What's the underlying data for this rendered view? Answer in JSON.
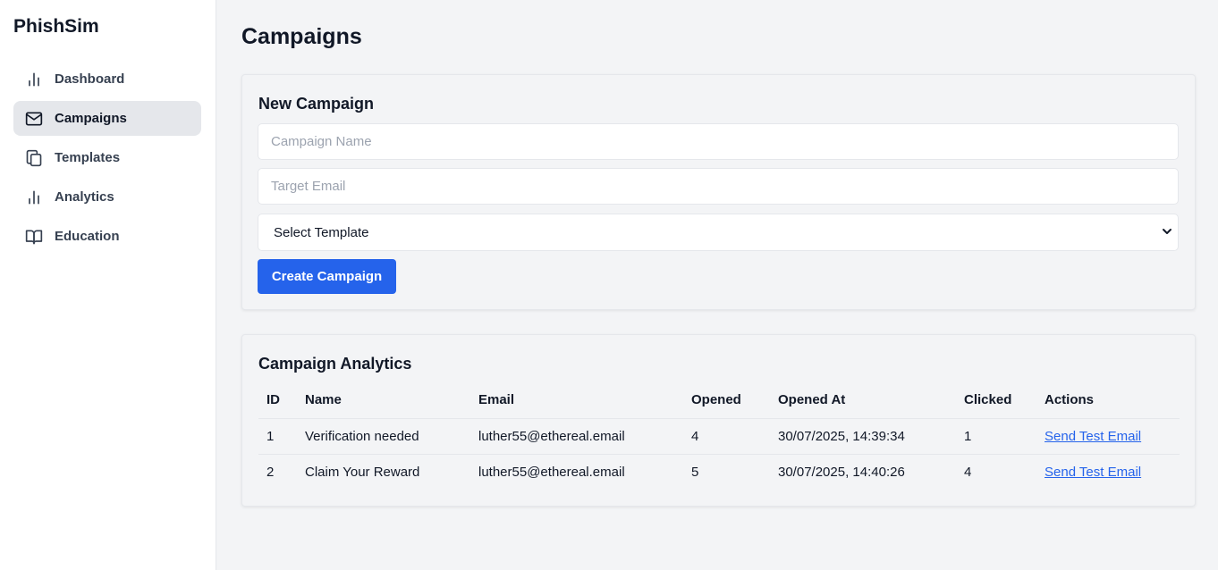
{
  "app": {
    "brand": "PhishSim"
  },
  "sidebar": {
    "items": [
      {
        "label": "Dashboard",
        "icon": "bar-chart-icon",
        "active": false
      },
      {
        "label": "Campaigns",
        "icon": "mail-icon",
        "active": true
      },
      {
        "label": "Templates",
        "icon": "copy-icon",
        "active": false
      },
      {
        "label": "Analytics",
        "icon": "bar-chart-icon",
        "active": false
      },
      {
        "label": "Education",
        "icon": "book-icon",
        "active": false
      }
    ]
  },
  "main": {
    "title": "Campaigns",
    "new_campaign": {
      "title": "New Campaign",
      "name_placeholder": "Campaign Name",
      "email_placeholder": "Target Email",
      "template_select": "Select Template",
      "create_label": "Create Campaign"
    },
    "analytics": {
      "title": "Campaign Analytics",
      "columns": [
        "ID",
        "Name",
        "Email",
        "Opened",
        "Opened At",
        "Clicked",
        "Actions"
      ],
      "rows": [
        {
          "id": "1",
          "name": "Verification needed",
          "email": "luther55@ethereal.email",
          "opened": "4",
          "opened_at": "30/07/2025, 14:39:34",
          "clicked": "1",
          "action": "Send Test Email"
        },
        {
          "id": "2",
          "name": "Claim Your Reward",
          "email": "luther55@ethereal.email",
          "opened": "5",
          "opened_at": "30/07/2025, 14:40:26",
          "clicked": "4",
          "action": "Send Test Email"
        }
      ]
    }
  },
  "colors": {
    "accent": "#2563eb",
    "background": "#f3f4f6",
    "sidebar_active": "#e5e7eb"
  }
}
